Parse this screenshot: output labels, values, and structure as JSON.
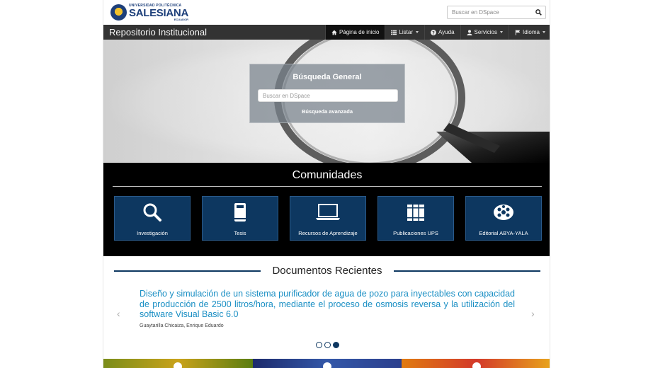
{
  "header": {
    "logo": {
      "line1": "UNIVERSIDAD POLITÉCNICA",
      "line2": "SALESIANA",
      "line3": "ECUADOR"
    },
    "search_placeholder": "Buscar en DSpace",
    "search_icon": "search-icon"
  },
  "navbar": {
    "brand": "Repositorio Institucional",
    "items": [
      {
        "label": "Página de inicio",
        "icon": "home-icon",
        "active": true
      },
      {
        "label": "Listar",
        "icon": "list-icon",
        "dropdown": true
      },
      {
        "label": "Ayuda",
        "icon": "question-icon"
      },
      {
        "label": "Servicios",
        "icon": "user-icon",
        "dropdown": true
      },
      {
        "label": "Idioma",
        "icon": "flag-icon",
        "dropdown": true
      }
    ]
  },
  "hero": {
    "title": "Búsqueda General",
    "search_placeholder": "Buscar en DSpace",
    "advanced_link": "Búsqueda avanzada"
  },
  "communities": {
    "title": "Comunidades",
    "tiles": [
      {
        "label": "Investigación",
        "icon": "search-icon"
      },
      {
        "label": "Tesis",
        "icon": "book-icon"
      },
      {
        "label": "Recursos de Aprendizaje",
        "icon": "laptop-icon"
      },
      {
        "label": "Publicaciones UPS",
        "icon": "books-icon"
      },
      {
        "label": "Editorial ABYA-YALA",
        "icon": "film-reel-icon"
      }
    ]
  },
  "recent": {
    "title": "Documentos Recientes",
    "document": {
      "title": "Diseño y simulación de un sistema purificador de agua de pozo para inyectables con capacidad de producción de 2500 litros/hora, mediante el proceso de osmosis reversa y la utilización del software Visual Basic 6.0",
      "author": "Guaytarilla Chicaiza, Enrique Eduardo"
    },
    "prev_arrow": "‹",
    "next_arrow": "›",
    "carousel_slides": 3,
    "carousel_active": 3
  },
  "colors": {
    "navbar": "#333333",
    "tile": "#0d3760",
    "link": "#1a8fc4",
    "communities_bg": "#000000"
  }
}
